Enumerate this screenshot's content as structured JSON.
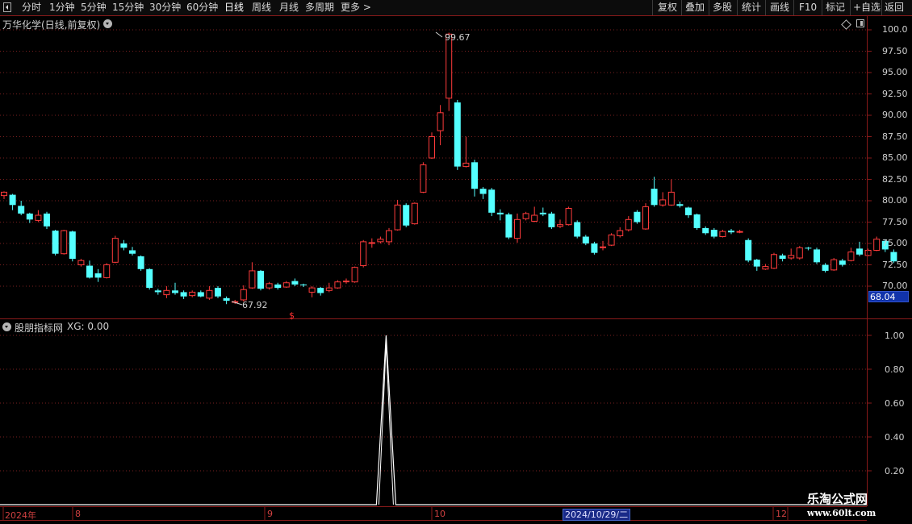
{
  "toolbar": {
    "periods": [
      "分时",
      "1分钟",
      "5分钟",
      "15分钟",
      "30分钟",
      "60分钟",
      "日线",
      "周线",
      "月线",
      "多周期",
      "更多 >"
    ],
    "active_period": "日线",
    "right_buttons": [
      "复权",
      "叠加",
      "多股",
      "统计",
      "画线",
      "F10",
      "标记",
      "+自选",
      "返回"
    ]
  },
  "main_chart": {
    "title": "万华化学(日线,前复权)",
    "last_price_tag": "68.04",
    "high_marker": "99.67",
    "low_marker": "67.92",
    "signal_marker": "$",
    "colors": {
      "up": "#ff3b3b",
      "down": "#54ffff",
      "grid": "#7a1f1f",
      "axis": "#8a1a1a"
    }
  },
  "indicator": {
    "title": "股朋指标网",
    "value_text": "XG: 0.00"
  },
  "date_axis": {
    "labels": [
      "2024年",
      "8",
      "9",
      "10",
      "12"
    ],
    "cursor_date": "2024/10/29/二"
  },
  "watermark": {
    "line1": "乐淘公式网",
    "line2": "www.60lt.com"
  },
  "chart_data": [
    {
      "type": "candlestick",
      "y_ticks": [
        "100.0",
        "97.50",
        "95.00",
        "92.50",
        "90.00",
        "87.50",
        "85.00",
        "82.50",
        "80.00",
        "77.50",
        "75.00",
        "72.50",
        "70.00"
      ],
      "ylim": [
        67.92,
        99.67
      ],
      "ohlc": [
        [
          80.6,
          81.0,
          80.2,
          81.1
        ],
        [
          80.7,
          79.5,
          78.9,
          80.8
        ],
        [
          79.4,
          78.5,
          78.3,
          80.0
        ],
        [
          78.5,
          77.8,
          77.4,
          78.6
        ],
        [
          77.7,
          78.3,
          77.5,
          78.9
        ],
        [
          78.5,
          77.0,
          76.7,
          78.7
        ],
        [
          76.5,
          73.8,
          73.6,
          76.6
        ],
        [
          73.8,
          76.5,
          73.7,
          76.6
        ],
        [
          76.4,
          73.2,
          72.9,
          76.5
        ],
        [
          72.5,
          73.0,
          72.3,
          73.2
        ],
        [
          72.4,
          71.0,
          70.9,
          73.0
        ],
        [
          71.5,
          71.0,
          70.5,
          72.0
        ],
        [
          71.0,
          72.5,
          70.9,
          72.7
        ],
        [
          72.8,
          75.6,
          72.7,
          75.9
        ],
        [
          75.0,
          74.5,
          74.2,
          75.4
        ],
        [
          74.2,
          73.8,
          73.6,
          74.6
        ],
        [
          73.5,
          72.0,
          71.8,
          73.6
        ],
        [
          72.0,
          69.8,
          69.6,
          72.1
        ],
        [
          69.5,
          69.3,
          69.0,
          69.7
        ],
        [
          69.0,
          69.5,
          68.6,
          70.0
        ],
        [
          69.5,
          69.2,
          69.0,
          70.4
        ],
        [
          69.3,
          68.8,
          68.5,
          69.5
        ],
        [
          68.9,
          69.3,
          68.7,
          69.5
        ],
        [
          69.3,
          68.8,
          68.7,
          69.5
        ],
        [
          68.6,
          69.5,
          68.4,
          70.0
        ],
        [
          69.8,
          68.8,
          68.6,
          70.0
        ],
        [
          68.6,
          68.3,
          67.9,
          68.8
        ],
        [
          68.2,
          68.2,
          67.92,
          68.4
        ],
        [
          68.4,
          69.6,
          68.2,
          70.1
        ],
        [
          69.8,
          71.8,
          69.7,
          72.8
        ],
        [
          71.8,
          69.7,
          69.5,
          71.9
        ],
        [
          69.8,
          70.3,
          69.6,
          70.5
        ],
        [
          70.2,
          69.8,
          69.6,
          70.4
        ],
        [
          69.9,
          70.4,
          69.8,
          70.6
        ],
        [
          70.6,
          70.2,
          70.0,
          70.9
        ],
        [
          70.2,
          70.1,
          69.9,
          70.3
        ],
        [
          69.3,
          69.8,
          68.7,
          70.0
        ],
        [
          69.8,
          69.2,
          68.9,
          69.9
        ],
        [
          69.5,
          69.8,
          69.3,
          70.4
        ],
        [
          69.8,
          70.5,
          69.7,
          70.7
        ],
        [
          70.6,
          70.6,
          70.3,
          70.9
        ],
        [
          70.5,
          72.2,
          70.4,
          72.3
        ],
        [
          72.4,
          75.2,
          72.2,
          75.4
        ],
        [
          75.0,
          75.1,
          74.5,
          75.6
        ],
        [
          75.2,
          75.5,
          75.0,
          75.8
        ],
        [
          75.2,
          76.5,
          74.8,
          76.8
        ],
        [
          76.6,
          79.5,
          76.5,
          80.1
        ],
        [
          79.5,
          77.1,
          76.9,
          79.7
        ],
        [
          77.3,
          79.7,
          77.2,
          79.8
        ],
        [
          81.0,
          84.2,
          80.9,
          84.5
        ],
        [
          85.0,
          87.5,
          84.9,
          88.0
        ],
        [
          88.2,
          90.3,
          86.5,
          91.2
        ],
        [
          92.0,
          99.5,
          90.5,
          99.67
        ],
        [
          91.5,
          84.0,
          83.6,
          91.8
        ],
        [
          84.0,
          84.4,
          83.9,
          87.5
        ],
        [
          84.5,
          81.4,
          80.5,
          84.8
        ],
        [
          81.4,
          80.8,
          80.2,
          81.6
        ],
        [
          81.3,
          78.6,
          78.2,
          81.5
        ],
        [
          78.6,
          78.4,
          77.7,
          79.0
        ],
        [
          78.4,
          75.7,
          75.5,
          78.6
        ],
        [
          75.6,
          77.8,
          75.1,
          78.5
        ],
        [
          77.9,
          78.5,
          77.7,
          78.7
        ],
        [
          77.6,
          78.3,
          77.5,
          79.3
        ],
        [
          78.6,
          78.4,
          78.2,
          79.2
        ],
        [
          78.5,
          76.9,
          76.7,
          78.7
        ],
        [
          77.0,
          77.2,
          76.8,
          77.8
        ],
        [
          77.2,
          79.1,
          77.1,
          79.3
        ],
        [
          77.5,
          75.8,
          75.6,
          77.7
        ],
        [
          75.8,
          75.0,
          74.8,
          76.0
        ],
        [
          75.0,
          73.9,
          73.7,
          75.2
        ],
        [
          74.5,
          74.6,
          74.2,
          75.3
        ],
        [
          74.8,
          76.0,
          74.7,
          76.2
        ],
        [
          75.9,
          76.5,
          75.7,
          76.9
        ],
        [
          76.6,
          77.8,
          76.4,
          78.2
        ],
        [
          78.7,
          77.5,
          77.3,
          78.9
        ],
        [
          76.7,
          79.3,
          76.6,
          79.7
        ],
        [
          81.4,
          79.5,
          79.3,
          82.8
        ],
        [
          79.5,
          80.1,
          79.3,
          81.0
        ],
        [
          79.5,
          81.0,
          79.4,
          82.5
        ],
        [
          79.6,
          79.4,
          79.2,
          79.9
        ],
        [
          79.2,
          78.3,
          78.0,
          79.3
        ],
        [
          78.4,
          76.8,
          76.6,
          78.5
        ],
        [
          76.8,
          76.2,
          76.0,
          77.0
        ],
        [
          76.6,
          75.8,
          75.6,
          76.8
        ],
        [
          75.8,
          76.4,
          75.7,
          76.6
        ],
        [
          76.5,
          76.3,
          76.1,
          76.7
        ],
        [
          76.4,
          76.4,
          76.2,
          76.6
        ],
        [
          75.4,
          73.0,
          72.8,
          75.6
        ],
        [
          73.1,
          72.3,
          71.8,
          73.2
        ],
        [
          72.0,
          72.3,
          71.9,
          72.6
        ],
        [
          72.1,
          73.7,
          72.0,
          73.9
        ],
        [
          73.6,
          73.2,
          72.9,
          73.8
        ],
        [
          73.3,
          73.6,
          73.1,
          74.4
        ],
        [
          73.3,
          74.5,
          73.1,
          74.7
        ],
        [
          74.5,
          74.4,
          74.2,
          74.6
        ],
        [
          74.3,
          72.8,
          72.6,
          74.5
        ],
        [
          72.5,
          71.8,
          71.6,
          72.7
        ],
        [
          71.9,
          73.1,
          71.8,
          73.3
        ],
        [
          73.0,
          72.5,
          72.3,
          73.2
        ],
        [
          73.0,
          74.0,
          72.9,
          74.5
        ],
        [
          74.4,
          73.7,
          73.5,
          75.2
        ],
        [
          73.6,
          74.2,
          73.5,
          74.4
        ],
        [
          74.2,
          75.5,
          74.1,
          75.8
        ],
        [
          75.3,
          74.3,
          74.0,
          75.5
        ],
        [
          74.0,
          72.9,
          72.7,
          74.3
        ]
      ]
    },
    {
      "type": "line",
      "name": "XG",
      "y_ticks": [
        "1.00",
        "0.80",
        "0.60",
        "0.40",
        "0.20"
      ],
      "ylim": [
        0,
        1
      ],
      "values": [
        0,
        0,
        0,
        0,
        0,
        0,
        0,
        0,
        0,
        0,
        0,
        0,
        0,
        0,
        0,
        0,
        0,
        0,
        0,
        0,
        0,
        0,
        0,
        0,
        0,
        0,
        0,
        0,
        0,
        0,
        0,
        0,
        0,
        0,
        0,
        0,
        0,
        0,
        0,
        0,
        0,
        0,
        0,
        0,
        0,
        0,
        0,
        0,
        0,
        1,
        0,
        0,
        0,
        0,
        0,
        0,
        0,
        0,
        0,
        0,
        0,
        0,
        0,
        0,
        0,
        0,
        0,
        0,
        0,
        0,
        0,
        0,
        0,
        0,
        0,
        0,
        0,
        0,
        0,
        0,
        0,
        0,
        0,
        0,
        0,
        0,
        0,
        0,
        0,
        0,
        0,
        0,
        0,
        0,
        0,
        0,
        0,
        0,
        0,
        0,
        0,
        0,
        0,
        0,
        0,
        0
      ]
    }
  ]
}
